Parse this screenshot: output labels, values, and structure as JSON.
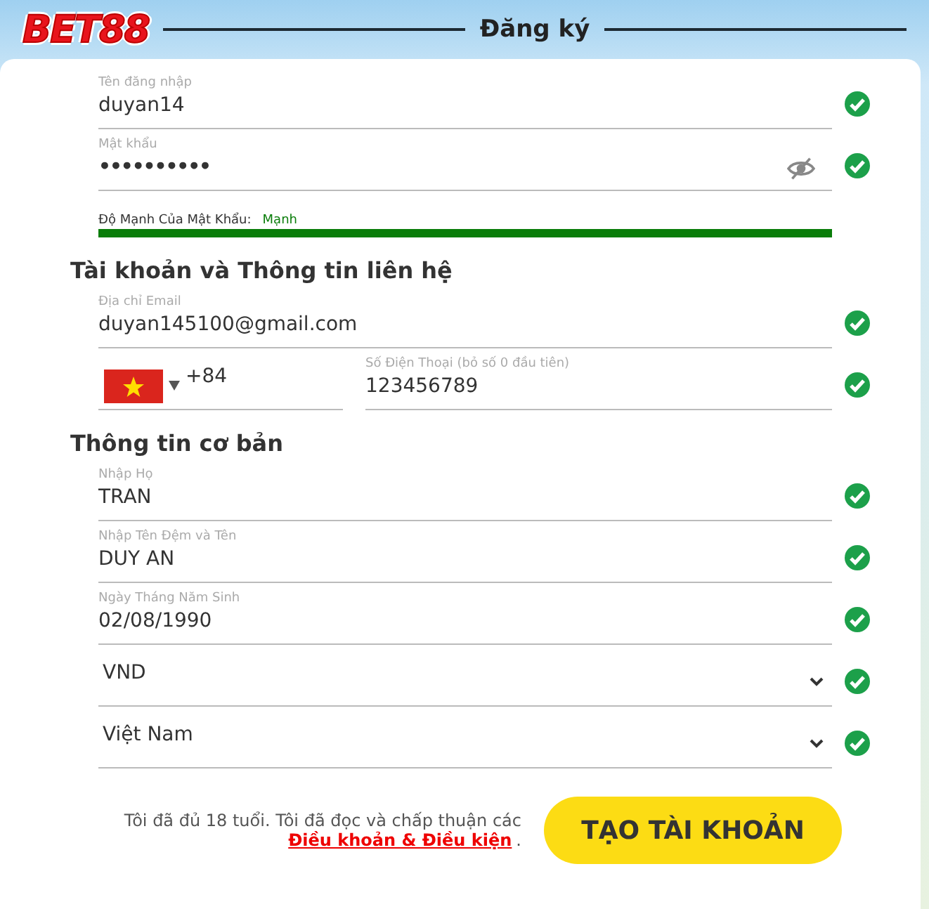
{
  "logo": "BET88",
  "title": "Đăng ký",
  "groups": [
    {
      "fields": [
        {
          "kind": "text",
          "label": "Tên đăng nhập",
          "value": "duyan14",
          "valid": true
        },
        {
          "kind": "password",
          "label": "Mật khẩu",
          "value": "••••••••••",
          "valid": true
        }
      ],
      "strength": {
        "label": "Độ Mạnh Của Mật Khẩu:",
        "value": "Mạnh",
        "level": 1
      }
    },
    {
      "heading": "Tài khoản và Thông tin liên hệ",
      "fields": [
        {
          "kind": "text",
          "label": "Địa chỉ Email",
          "value": "duyan145100@gmail.com",
          "valid": true
        },
        {
          "kind": "phone",
          "code": "+84",
          "label": "Số Điện Thoại (bỏ số 0 đầu tiên)",
          "value": "123456789",
          "valid": true
        }
      ]
    },
    {
      "heading": "Thông tin cơ bản",
      "fields": [
        {
          "kind": "text",
          "label": "Nhập Họ",
          "value": "TRAN",
          "valid": true
        },
        {
          "kind": "text",
          "label": "Nhập Tên Đệm và Tên",
          "value": "DUY AN",
          "valid": true
        },
        {
          "kind": "text",
          "label": "Ngày Tháng Năm Sinh",
          "value": "02/08/1990",
          "valid": true
        },
        {
          "kind": "select",
          "value": "VND",
          "valid": true
        },
        {
          "kind": "select",
          "value": "Việt Nam",
          "valid": true
        }
      ]
    }
  ],
  "terms": {
    "text": "Tôi đã đủ 18 tuổi. Tôi đã đọc và chấp thuận các",
    "link": "Điều khoản & Điều kiện",
    "end": "."
  },
  "submit": "TẠO TÀI KHOẢN"
}
